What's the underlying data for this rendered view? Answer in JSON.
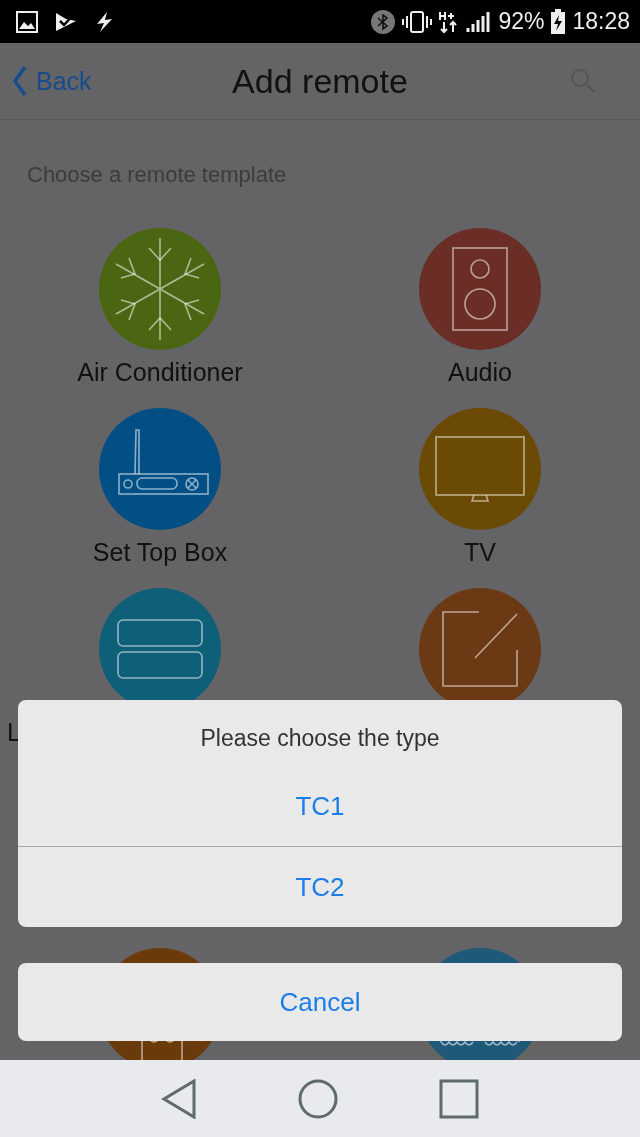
{
  "status_bar": {
    "battery_percent": "92%",
    "time": "18:28"
  },
  "app_bar": {
    "back_label": "Back",
    "title": "Add remote"
  },
  "section_title": "Choose a remote template",
  "templates": [
    {
      "label": "Air Conditioner",
      "color": "#4b6612",
      "kind": "normal"
    },
    {
      "label": "Audio",
      "color": "#6b2e26",
      "kind": "normal"
    },
    {
      "label": "Set Top Box",
      "color": "#024f85",
      "kind": "normal"
    },
    {
      "label": "TV",
      "color": "#6b4a05",
      "kind": "normal"
    },
    {
      "label": "L",
      "color": "#0e5f78",
      "kind": "clipped"
    },
    {
      "color": "#6b3a14",
      "kind": "unlabeled"
    },
    {
      "color": "#6a3a0a",
      "kind": "unlabeled"
    },
    {
      "color": "#1e5a78",
      "kind": "unlabeled"
    }
  ],
  "dialog": {
    "title": "Please choose the type",
    "options": [
      "TC1",
      "TC2"
    ],
    "cancel": "Cancel"
  }
}
